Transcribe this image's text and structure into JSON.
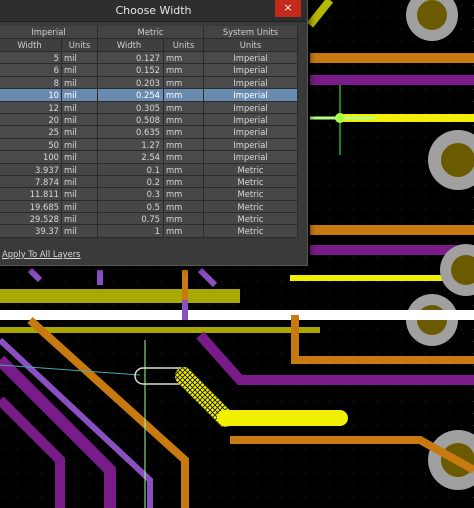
{
  "dialog": {
    "title": "Choose Width",
    "close_glyph": "×",
    "groups": {
      "imperial": "Imperial",
      "metric": "Metric",
      "system": "System Units"
    },
    "headers": {
      "imp_width": "Width",
      "imp_units": "Units",
      "met_width": "Width",
      "met_units": "Units",
      "sys_units": "Units"
    },
    "rows": [
      {
        "imp_width": "5",
        "imp_units": "mil",
        "met_width": "0.127",
        "met_units": "mm",
        "sys_units": "Imperial"
      },
      {
        "imp_width": "6",
        "imp_units": "mil",
        "met_width": "0.152",
        "met_units": "mm",
        "sys_units": "Imperial"
      },
      {
        "imp_width": "8",
        "imp_units": "mil",
        "met_width": "0.203",
        "met_units": "mm",
        "sys_units": "Imperial"
      },
      {
        "imp_width": "10",
        "imp_units": "mil",
        "met_width": "0.254",
        "met_units": "mm",
        "sys_units": "Imperial"
      },
      {
        "imp_width": "12",
        "imp_units": "mil",
        "met_width": "0.305",
        "met_units": "mm",
        "sys_units": "Imperial"
      },
      {
        "imp_width": "20",
        "imp_units": "mil",
        "met_width": "0.508",
        "met_units": "mm",
        "sys_units": "Imperial"
      },
      {
        "imp_width": "25",
        "imp_units": "mil",
        "met_width": "0.635",
        "met_units": "mm",
        "sys_units": "Imperial"
      },
      {
        "imp_width": "50",
        "imp_units": "mil",
        "met_width": "1.27",
        "met_units": "mm",
        "sys_units": "Imperial"
      },
      {
        "imp_width": "100",
        "imp_units": "mil",
        "met_width": "2.54",
        "met_units": "mm",
        "sys_units": "Imperial"
      },
      {
        "imp_width": "3.937",
        "imp_units": "mil",
        "met_width": "0.1",
        "met_units": "mm",
        "sys_units": "Metric"
      },
      {
        "imp_width": "7.874",
        "imp_units": "mil",
        "met_width": "0.2",
        "met_units": "mm",
        "sys_units": "Metric"
      },
      {
        "imp_width": "11.811",
        "imp_units": "mil",
        "met_width": "0.3",
        "met_units": "mm",
        "sys_units": "Metric"
      },
      {
        "imp_width": "19.685",
        "imp_units": "mil",
        "met_width": "0.5",
        "met_units": "mm",
        "sys_units": "Metric"
      },
      {
        "imp_width": "29.528",
        "imp_units": "mil",
        "met_width": "0.75",
        "met_units": "mm",
        "sys_units": "Metric"
      },
      {
        "imp_width": "39.37",
        "imp_units": "mil",
        "met_width": "1",
        "met_units": "mm",
        "sys_units": "Metric"
      }
    ],
    "selected_index": 3,
    "apply_label": "Apply To All Layers"
  },
  "colors": {
    "track_yellow": "#f0f000",
    "track_orange": "#c87a10",
    "track_purple": "#7a1b8a",
    "track_violet": "#8a4fc0",
    "track_olive": "#a8a800",
    "pad_gray": "#a0a0a0",
    "pad_center": "#6b5a00",
    "selection_blue": "#6a8bb0",
    "cursor_green": "#3cff3c"
  }
}
